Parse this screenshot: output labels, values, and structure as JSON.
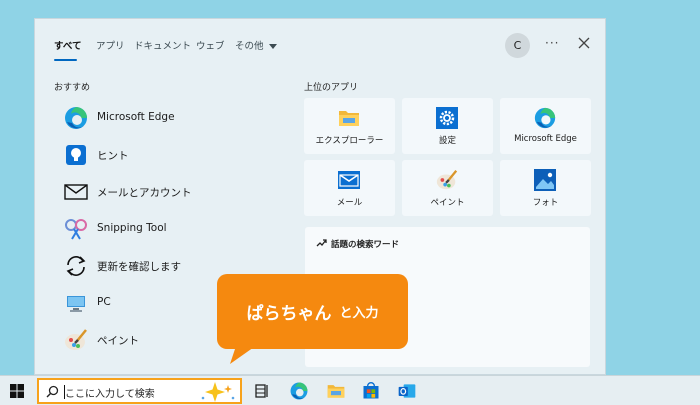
{
  "tabs": [
    {
      "label": "すべて",
      "active": true
    },
    {
      "label": "アプリ"
    },
    {
      "label": "ドキュメント"
    },
    {
      "label": "ウェブ"
    },
    {
      "label": "その他"
    }
  ],
  "account_initial": "C",
  "more_label": "···",
  "recommended": {
    "title": "おすすめ",
    "items": [
      {
        "label": "Microsoft Edge",
        "icon": "edge-icon"
      },
      {
        "label": "ヒント",
        "icon": "tips-icon"
      },
      {
        "label": "メールとアカウント",
        "icon": "mail-outline-icon"
      },
      {
        "label": "Snipping Tool",
        "icon": "snipping-tool-icon"
      },
      {
        "label": "更新を確認します",
        "icon": "sync-icon"
      },
      {
        "label": "PC",
        "icon": "pc-icon"
      },
      {
        "label": "ペイント",
        "icon": "paint-icon"
      }
    ]
  },
  "top_apps": {
    "title": "上位のアプリ",
    "items": [
      {
        "label": "エクスプローラー",
        "icon": "folder-icon"
      },
      {
        "label": "設定",
        "icon": "settings-gear-icon"
      },
      {
        "label": "Microsoft Edge",
        "icon": "edge-icon"
      },
      {
        "label": "メール",
        "icon": "mail-icon"
      },
      {
        "label": "ペイント",
        "icon": "paint-icon"
      },
      {
        "label": "フォト",
        "icon": "photos-icon"
      }
    ]
  },
  "search_words": {
    "title": "話題の検索ワード"
  },
  "taskbar": {
    "search_text": "ここに入力して検索"
  },
  "callout": {
    "strong": "ぱらちゃん",
    "small": "と入力"
  },
  "colors": {
    "accent": "#0067c0",
    "callout": "#f5890f",
    "search_highlight": "#f7a21b",
    "desktop": "#8fd3e6"
  }
}
